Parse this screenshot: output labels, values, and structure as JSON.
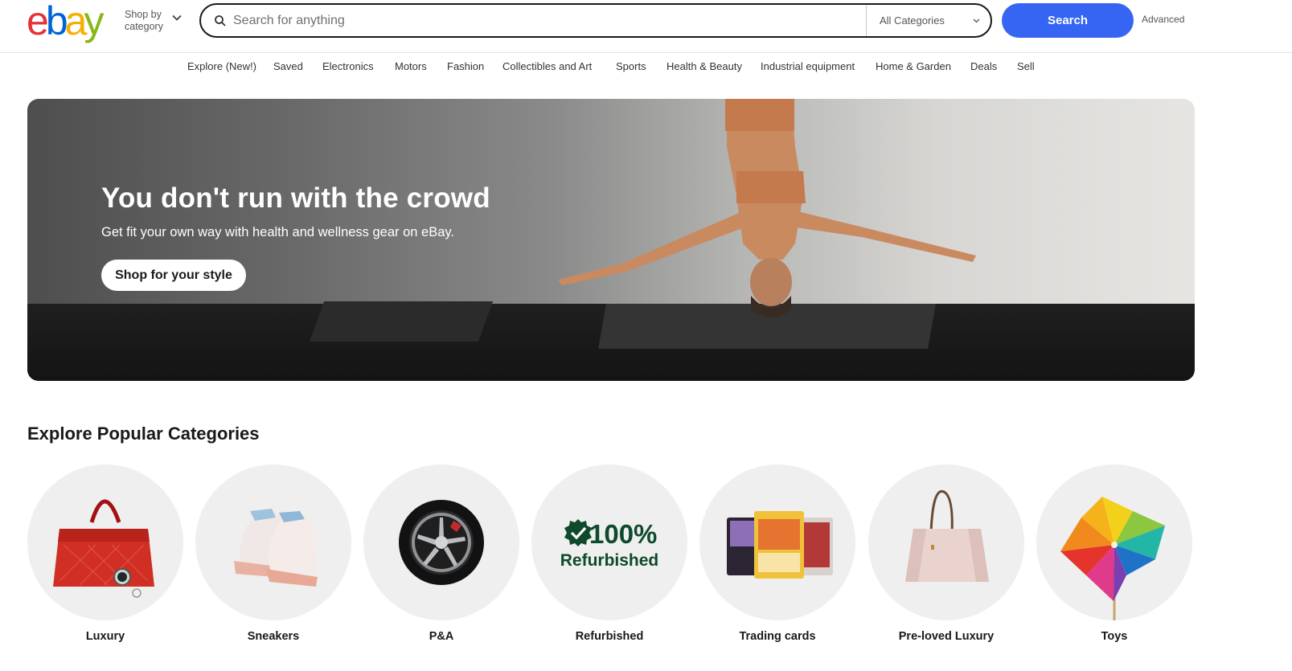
{
  "header": {
    "logo_letters": [
      "e",
      "b",
      "a",
      "y"
    ],
    "shop_by_line1": "Shop by",
    "shop_by_line2": "category",
    "search_placeholder": "Search for anything",
    "category_select": "All Categories",
    "search_button": "Search",
    "advanced_link": "Advanced"
  },
  "nav": {
    "items": [
      "Explore (New!)",
      "Saved",
      "Electronics",
      "Motors",
      "Fashion",
      "Collectibles and Art",
      "Sports",
      "Health & Beauty",
      "Industrial equipment",
      "Home & Garden",
      "Deals",
      "Sell"
    ]
  },
  "hero": {
    "title": "You don't run with the crowd",
    "subtitle": "Get fit your own way with health and wellness gear on eBay.",
    "cta": "Shop for your style"
  },
  "categories": {
    "title": "Explore Popular Categories",
    "items": [
      {
        "label": "Luxury",
        "icon": "handbag-watch-icon"
      },
      {
        "label": "Sneakers",
        "icon": "sneakers-icon"
      },
      {
        "label": "P&A",
        "icon": "wheel-icon"
      },
      {
        "label": "Refurbished",
        "icon": "refurbished-badge-icon",
        "badge_percent": "100%",
        "badge_word": "Refurbished"
      },
      {
        "label": "Trading cards",
        "icon": "trading-cards-icon"
      },
      {
        "label": "Pre-loved Luxury",
        "icon": "tote-bag-icon"
      },
      {
        "label": "Toys",
        "icon": "pinwheel-icon"
      }
    ]
  },
  "colors": {
    "ebay_red": "#e53238",
    "ebay_blue": "#0064d2",
    "ebay_yellow": "#f5af02",
    "ebay_green": "#86b817",
    "search_button": "#3665f3",
    "refurb_green": "#0e4a2b"
  }
}
